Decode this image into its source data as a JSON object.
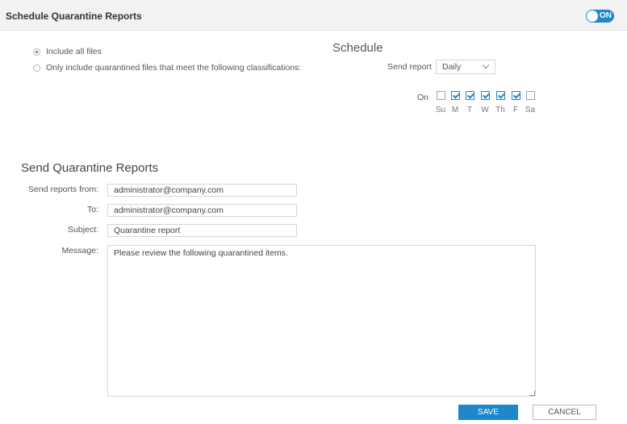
{
  "header": {
    "title": "Schedule Quarantine Reports",
    "toggle_label": "ON",
    "toggle_color": "#1e88c9"
  },
  "file_options": {
    "include_all": "Include all files",
    "only_classified": "Only include quarantined files that meet the following classifications:",
    "selected": "include_all"
  },
  "schedule": {
    "heading": "Schedule",
    "send_report_label": "Send report",
    "frequency": "Daily",
    "on_label": "On",
    "days": [
      {
        "label": "Su",
        "checked": false
      },
      {
        "label": "M",
        "checked": true
      },
      {
        "label": "T",
        "checked": true
      },
      {
        "label": "W",
        "checked": true
      },
      {
        "label": "Th",
        "checked": true
      },
      {
        "label": "F",
        "checked": true
      },
      {
        "label": "Sa",
        "checked": false
      }
    ]
  },
  "send_reports": {
    "heading": "Send Quarantine Reports",
    "from_label": "Send reports from:",
    "from_value": "administrator@company.com",
    "to_label": "To:",
    "to_value": "administrator@company.com",
    "subject_label": "Subject:",
    "subject_value": "Quarantine report",
    "message_label": "Message:",
    "message_value": "Please review the following quarantined items."
  },
  "buttons": {
    "save": "SAVE",
    "cancel": "CANCEL"
  },
  "icons": {
    "toggle": "toggle-switch-icon",
    "select": "chevron-down-icon",
    "resize": "resize-grip-icon"
  }
}
